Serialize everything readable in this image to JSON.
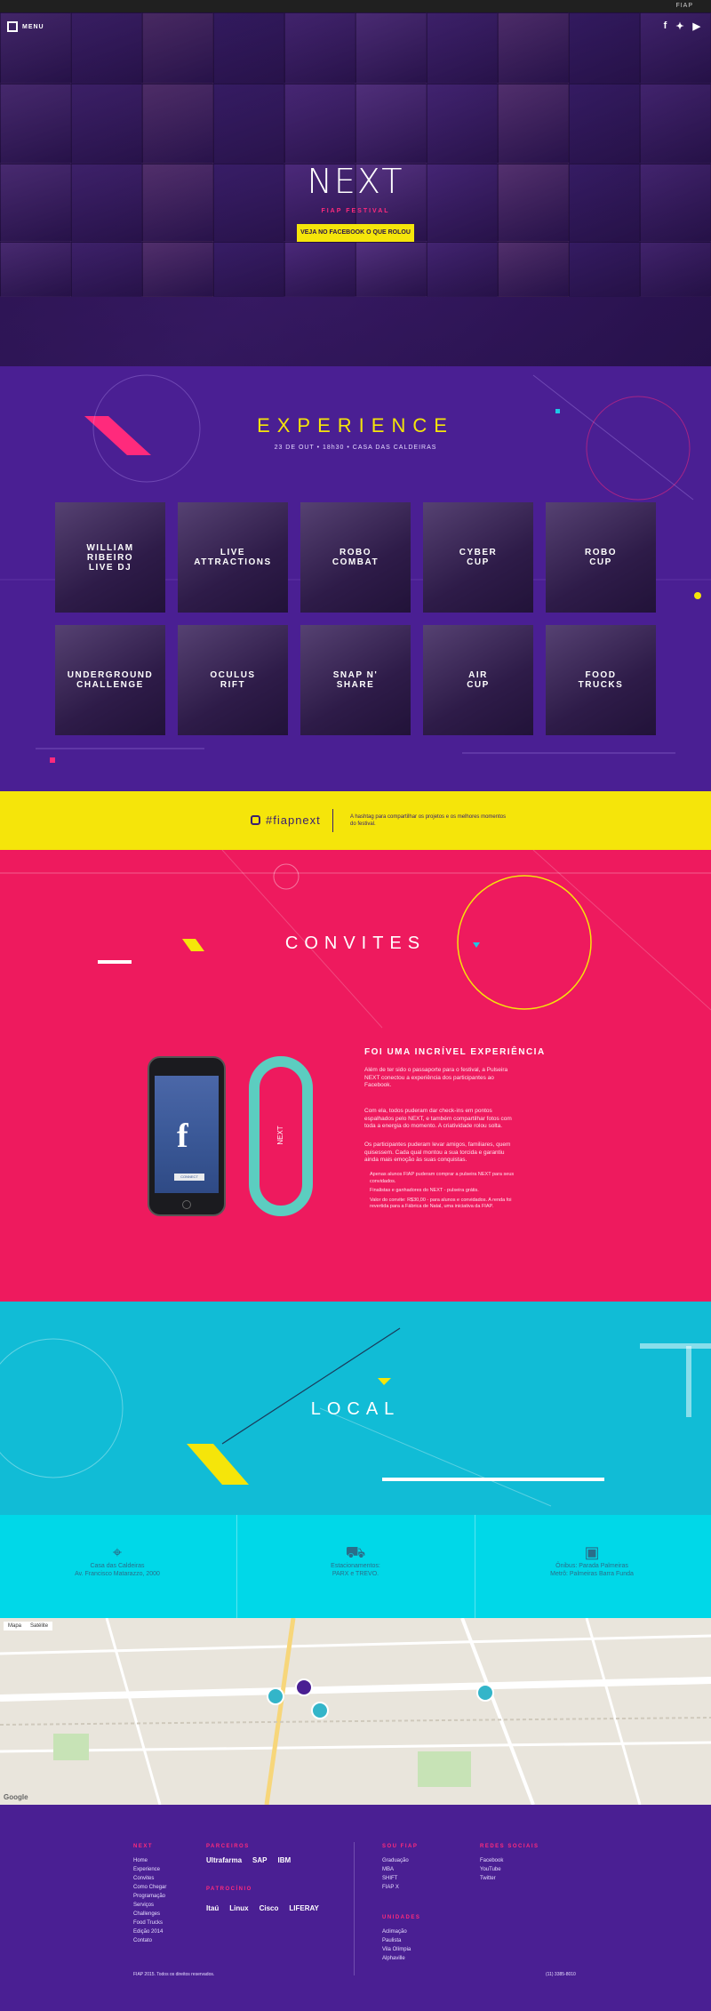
{
  "topbar": {
    "brand": "FIAP"
  },
  "hero": {
    "menu_label": "MENU",
    "social_icons": [
      "facebook-icon",
      "twitter-icon",
      "youtube-icon"
    ],
    "logo_word": "NEXT",
    "logo_sub": "FIAP FESTIVAL",
    "cta": "VEJA NO FACEBOOK O QUE ROLOU"
  },
  "experience": {
    "title": "EXPERIENCE",
    "date": "23 DE OUT • 18h30 • CASA DAS CALDEIRAS",
    "cards": [
      "WILLIAM\nRIBEIRO\nLIVE DJ",
      "LIVE\nATTRACTIONS",
      "ROBO\nCOMBAT",
      "CYBER\nCUP",
      "ROBO\nCUP",
      "UNDERGROUND\nCHALLENGE",
      "OCULUS\nRIFT",
      "SNAP N'\nSHARE",
      "AIR\nCUP",
      "FOOD\nTRUCKS"
    ]
  },
  "hashtag": {
    "tag": "#fiapnext",
    "desc": "A hashtag para compartilhar os projetos e os melhores momentos do festival."
  },
  "convites": {
    "title": "CONVITES",
    "heading": "FOI UMA INCRÍVEL EXPERIÊNCIA",
    "p1": "Além de ter sido o passaporte para o festival, a Pulseira NEXT conectou a experiência dos participantes ao Facebook.",
    "p2": "Com ela, todos puderam dar check-ins em pontos espalhados pelo NEXT, e também compartilhar fotos com toda a energia do momento. A criatividade rolou solta.",
    "p3": "Os participantes puderam levar amigos, familiares, quem quisessem. Cada qual montou a sua torcida e garantiu ainda mais emoção às suas conquistas.",
    "bullets": [
      "Apenas alunos FIAP puderam comprar a pulseira NEXT para seus convidados.",
      "Finalistas e ganhadores do NEXT - pulseira grátis.",
      "Valor do convite: R$30,00 - para alunos e convidados. A renda foi revertida para a Fábrica de Natal, uma iniciativa da FIAP."
    ],
    "phone_connect": "CONNECT",
    "band_text": "NEXT"
  },
  "local": {
    "title": "LOCAL",
    "items": [
      {
        "icon": "location-pin-icon",
        "line1": "Casa das Caldeiras",
        "line2": "Av. Francisco Matarazzo, 2000"
      },
      {
        "icon": "car-icon",
        "line1": "Estacionamentos:",
        "line2": "PARX e TREVO."
      },
      {
        "icon": "bus-icon",
        "line1": "Ônibus: Parada Palmeiras",
        "line2": "Metrô: Palmeiras Barra Funda"
      }
    ]
  },
  "map": {
    "tabs": [
      "Mapa",
      "Satélite"
    ],
    "provider": "Google"
  },
  "footer": {
    "cols": {
      "next": {
        "title": "NEXT",
        "items": [
          "Home",
          "Experience",
          "Convites",
          "Como Chegar",
          "Programação",
          "Serviços",
          "Challenges",
          "Food Trucks",
          "Edição 2014",
          "Contato"
        ]
      },
      "parceiros": {
        "title": "PARCEIROS",
        "logos": [
          "Ultrafarma",
          "SAP",
          "IBM"
        ]
      },
      "patrocinio": {
        "title": "PATROCÍNIO",
        "logos": [
          "Itaú",
          "Linux",
          "Cisco",
          "LIFERAY"
        ]
      },
      "sou_fiap": {
        "title": "SOU FIAP",
        "items": [
          "Graduação",
          "MBA",
          "SHIFT",
          "FIAP X"
        ]
      },
      "unidades": {
        "title": "UNIDADES",
        "items": [
          "Aclimação",
          "Paulista",
          "Vila Olímpia",
          "Alphaville"
        ]
      },
      "redes": {
        "title": "REDES SOCIAIS",
        "items": [
          "Facebook",
          "YouTube",
          "Twitter"
        ]
      }
    },
    "copyright": "FIAP 2015. Todos os direitos reservados.",
    "phone": "(11) 3385-8010"
  }
}
